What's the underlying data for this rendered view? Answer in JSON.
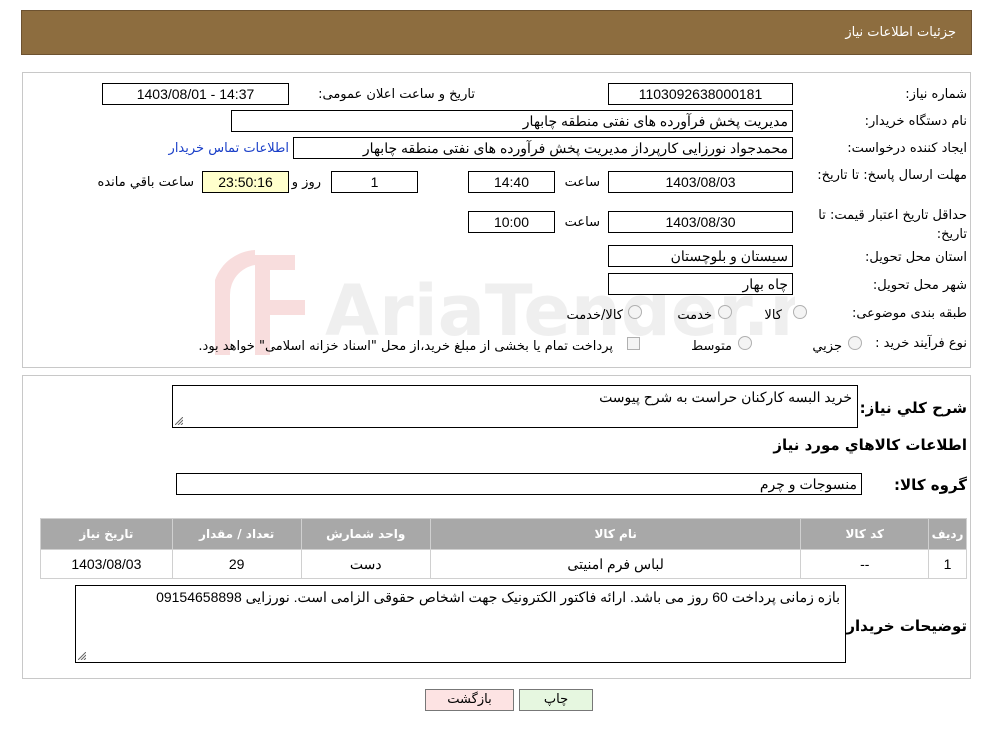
{
  "header": {
    "title": "جزئیات اطلاعات نیاز"
  },
  "labels": {
    "need_number": "شماره نیاز:",
    "announce_datetime": "تاریخ و ساعت اعلان عمومی:",
    "buyer_org": "نام دستگاه خریدار:",
    "requester": "ایجاد کننده درخواست:",
    "contact_link": "اطلاعات تماس خریدار",
    "deadline": "مهلت ارسال پاسخ: تا تاریخ:",
    "time": "ساعت",
    "days_and": "روز و",
    "remaining": "ساعت باقي مانده",
    "price_validity": "حداقل تاریخ اعتبار قیمت: تا تاریخ:",
    "province": "استان محل تحویل:",
    "city": "شهر محل تحویل:",
    "category": "طبقه بندی موضوعی:",
    "process_type": "نوع فرآیند خرید :",
    "general_desc": "شرح کلي نیاز:",
    "items_info": "اطلاعات کالاهاي مورد نیاز",
    "goods_group": "گروه کالا:",
    "buyer_notes": "توضیحات خریدار:"
  },
  "values": {
    "need_number": "1103092638000181",
    "announce_datetime": "1403/08/01 - 14:37",
    "buyer_org": "مدیریت پخش فرآورده های نفتی منطقه چابهار",
    "requester": "محمدجواد نورزایی کارپرداز مدیریت پخش فرآورده های نفتی منطقه چابهار",
    "deadline_date": "1403/08/03",
    "deadline_time": "14:40",
    "days": "1",
    "remaining_time": "23:50:16",
    "validity_date": "1403/08/30",
    "validity_time": "10:00",
    "province": "سیستان و بلوچستان",
    "city": "چاه بهار",
    "general_desc": "خرید البسه کارکنان حراست به شرح پیوست",
    "goods_group": "منسوجات و چرم",
    "buyer_notes": "بازه زمانی پرداخت 60 روز می باشد. ارائه فاکتور الکترونیک جهت اشخاص حقوقی الزامی است. نورزایی 09154658898"
  },
  "category_options": [
    "کالا",
    "خدمت",
    "کالا/خدمت"
  ],
  "process_options": [
    "جزيي",
    "متوسط"
  ],
  "payment_note": "پرداخت تمام یا بخشی از مبلغ خرید،از محل \"اسناد خزانه اسلامی\" خواهد بود.",
  "table": {
    "headers": [
      "ردیف",
      "کد کالا",
      "نام کالا",
      "واحد شمارش",
      "تعداد / مقدار",
      "تاریخ نیاز"
    ],
    "rows": [
      [
        "1",
        "--",
        "لباس فرم امنیتی",
        "دست",
        "29",
        "1403/08/03"
      ]
    ]
  },
  "buttons": {
    "print": "چاپ",
    "back": "بازگشت"
  },
  "watermark": "AriaTender.neT",
  "colors": {
    "header_bg": "#8d6d3f",
    "table_header_bg": "#a8a8a8",
    "back_button_bg": "#fde3e3",
    "print_button_bg": "#e6f7e0"
  }
}
